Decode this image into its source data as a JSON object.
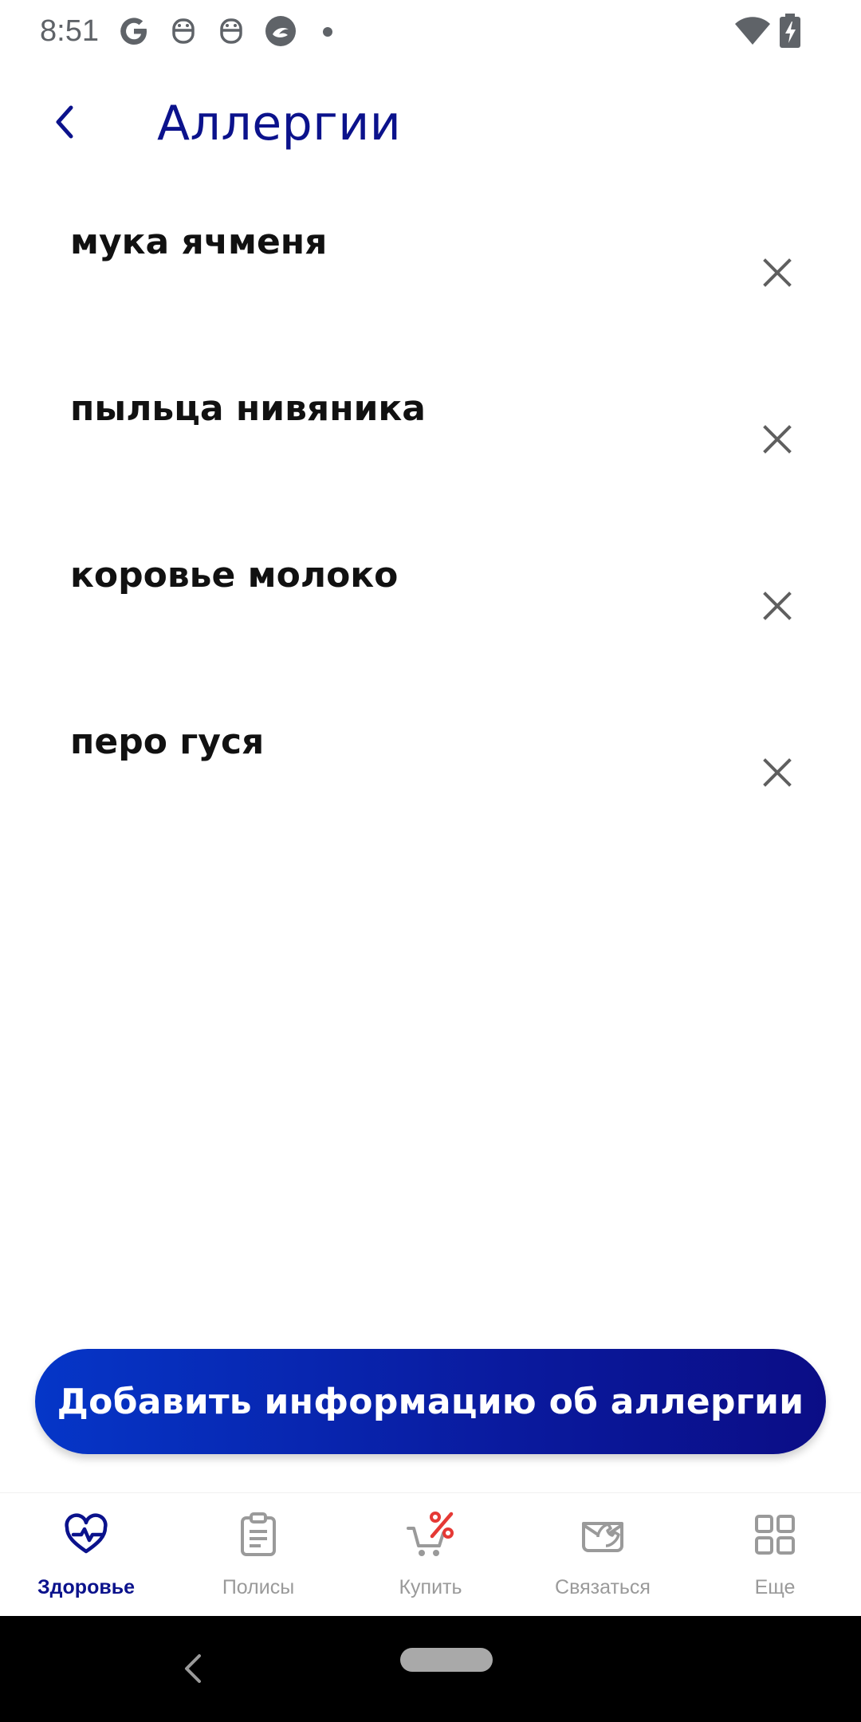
{
  "status_bar": {
    "time": "8:51",
    "notification_icons": [
      "google-icon",
      "robot-icon",
      "robot-icon",
      "circle-app-icon",
      "dot-icon"
    ],
    "right_icons": [
      "wifi-icon",
      "battery-charging-icon"
    ]
  },
  "header": {
    "title": "Аллергии",
    "back_icon": "chevron-left-icon"
  },
  "allergies": [
    {
      "name": "мука ячменя"
    },
    {
      "name": "пыльца нивяника"
    },
    {
      "name": "коровье молоко"
    },
    {
      "name": "перо гуся"
    }
  ],
  "remove_icon": "close-icon",
  "add_button": {
    "label": "Добавить информацию об аллергии"
  },
  "bottom_nav": {
    "items": [
      {
        "label": "Здоровье",
        "icon": "heart-pulse-icon",
        "active": true
      },
      {
        "label": "Полисы",
        "icon": "clipboard-icon",
        "active": false
      },
      {
        "label": "Купить",
        "icon": "cart-percent-icon",
        "active": false
      },
      {
        "label": "Связаться",
        "icon": "envelope-phone-icon",
        "active": false
      },
      {
        "label": "Еще",
        "icon": "grid-icon",
        "active": false
      }
    ]
  },
  "colors": {
    "accent": "#0b128c",
    "button_gradient_start": "#0536c8",
    "button_gradient_end": "#0b0d86",
    "inactive": "#9a9a9a",
    "sale_badge": "#e53935"
  }
}
